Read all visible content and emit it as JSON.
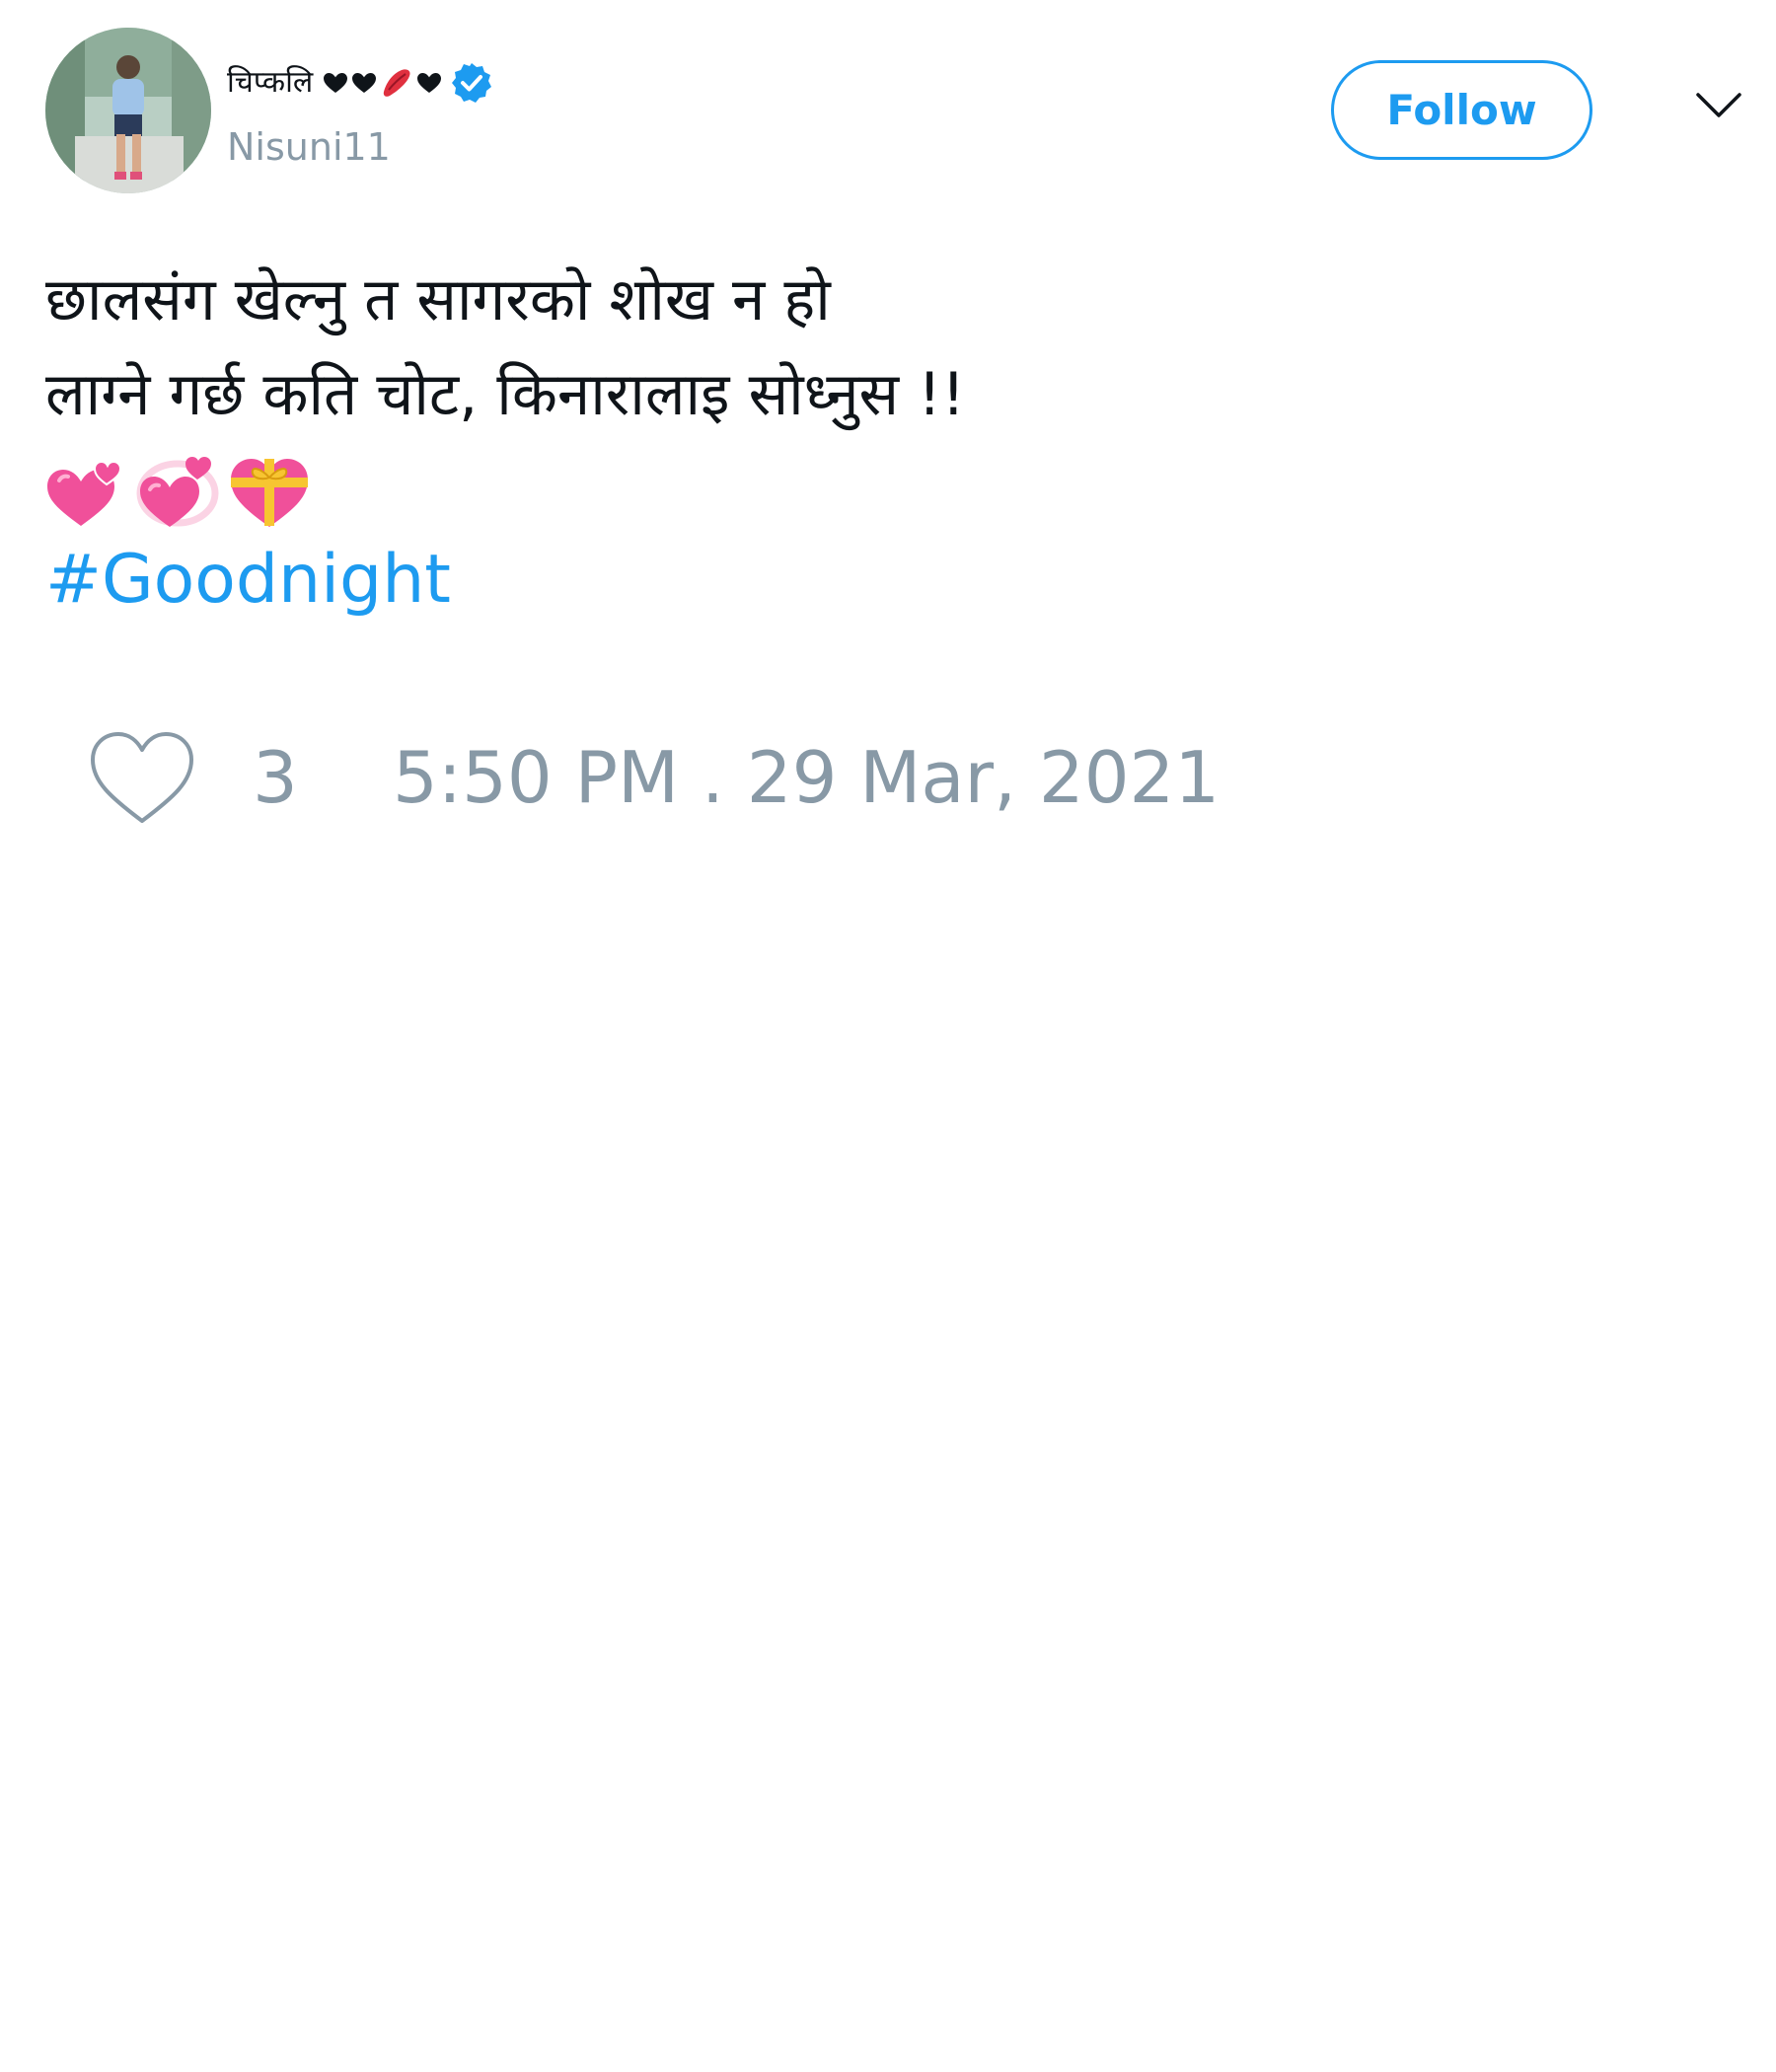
{
  "author": {
    "display_name": "चिप्कलि",
    "name_emoji": [
      "heart-black",
      "heart-black",
      "kiss-mark",
      "heart-black"
    ],
    "handle": "Nisuni11",
    "verified": true
  },
  "header": {
    "follow_label": "Follow"
  },
  "tweet": {
    "lines": [
      "छालसंग खेल्नु त सागरको शोख न हो",
      "लाग्ने गर्छ कति चोट, किनारालाइ सोध्नुस !!"
    ],
    "emoji": [
      "two-hearts",
      "revolving-hearts",
      "heart-with-ribbon"
    ],
    "hashtag": "#Goodnight"
  },
  "footer": {
    "like_count": "3",
    "timestamp": "5:50 PM . 29 Mar, 2021"
  },
  "colors": {
    "accent": "#1d9bf0",
    "muted": "#8899a6",
    "text": "#0f1419",
    "emoji_pink": "#f0509a"
  }
}
